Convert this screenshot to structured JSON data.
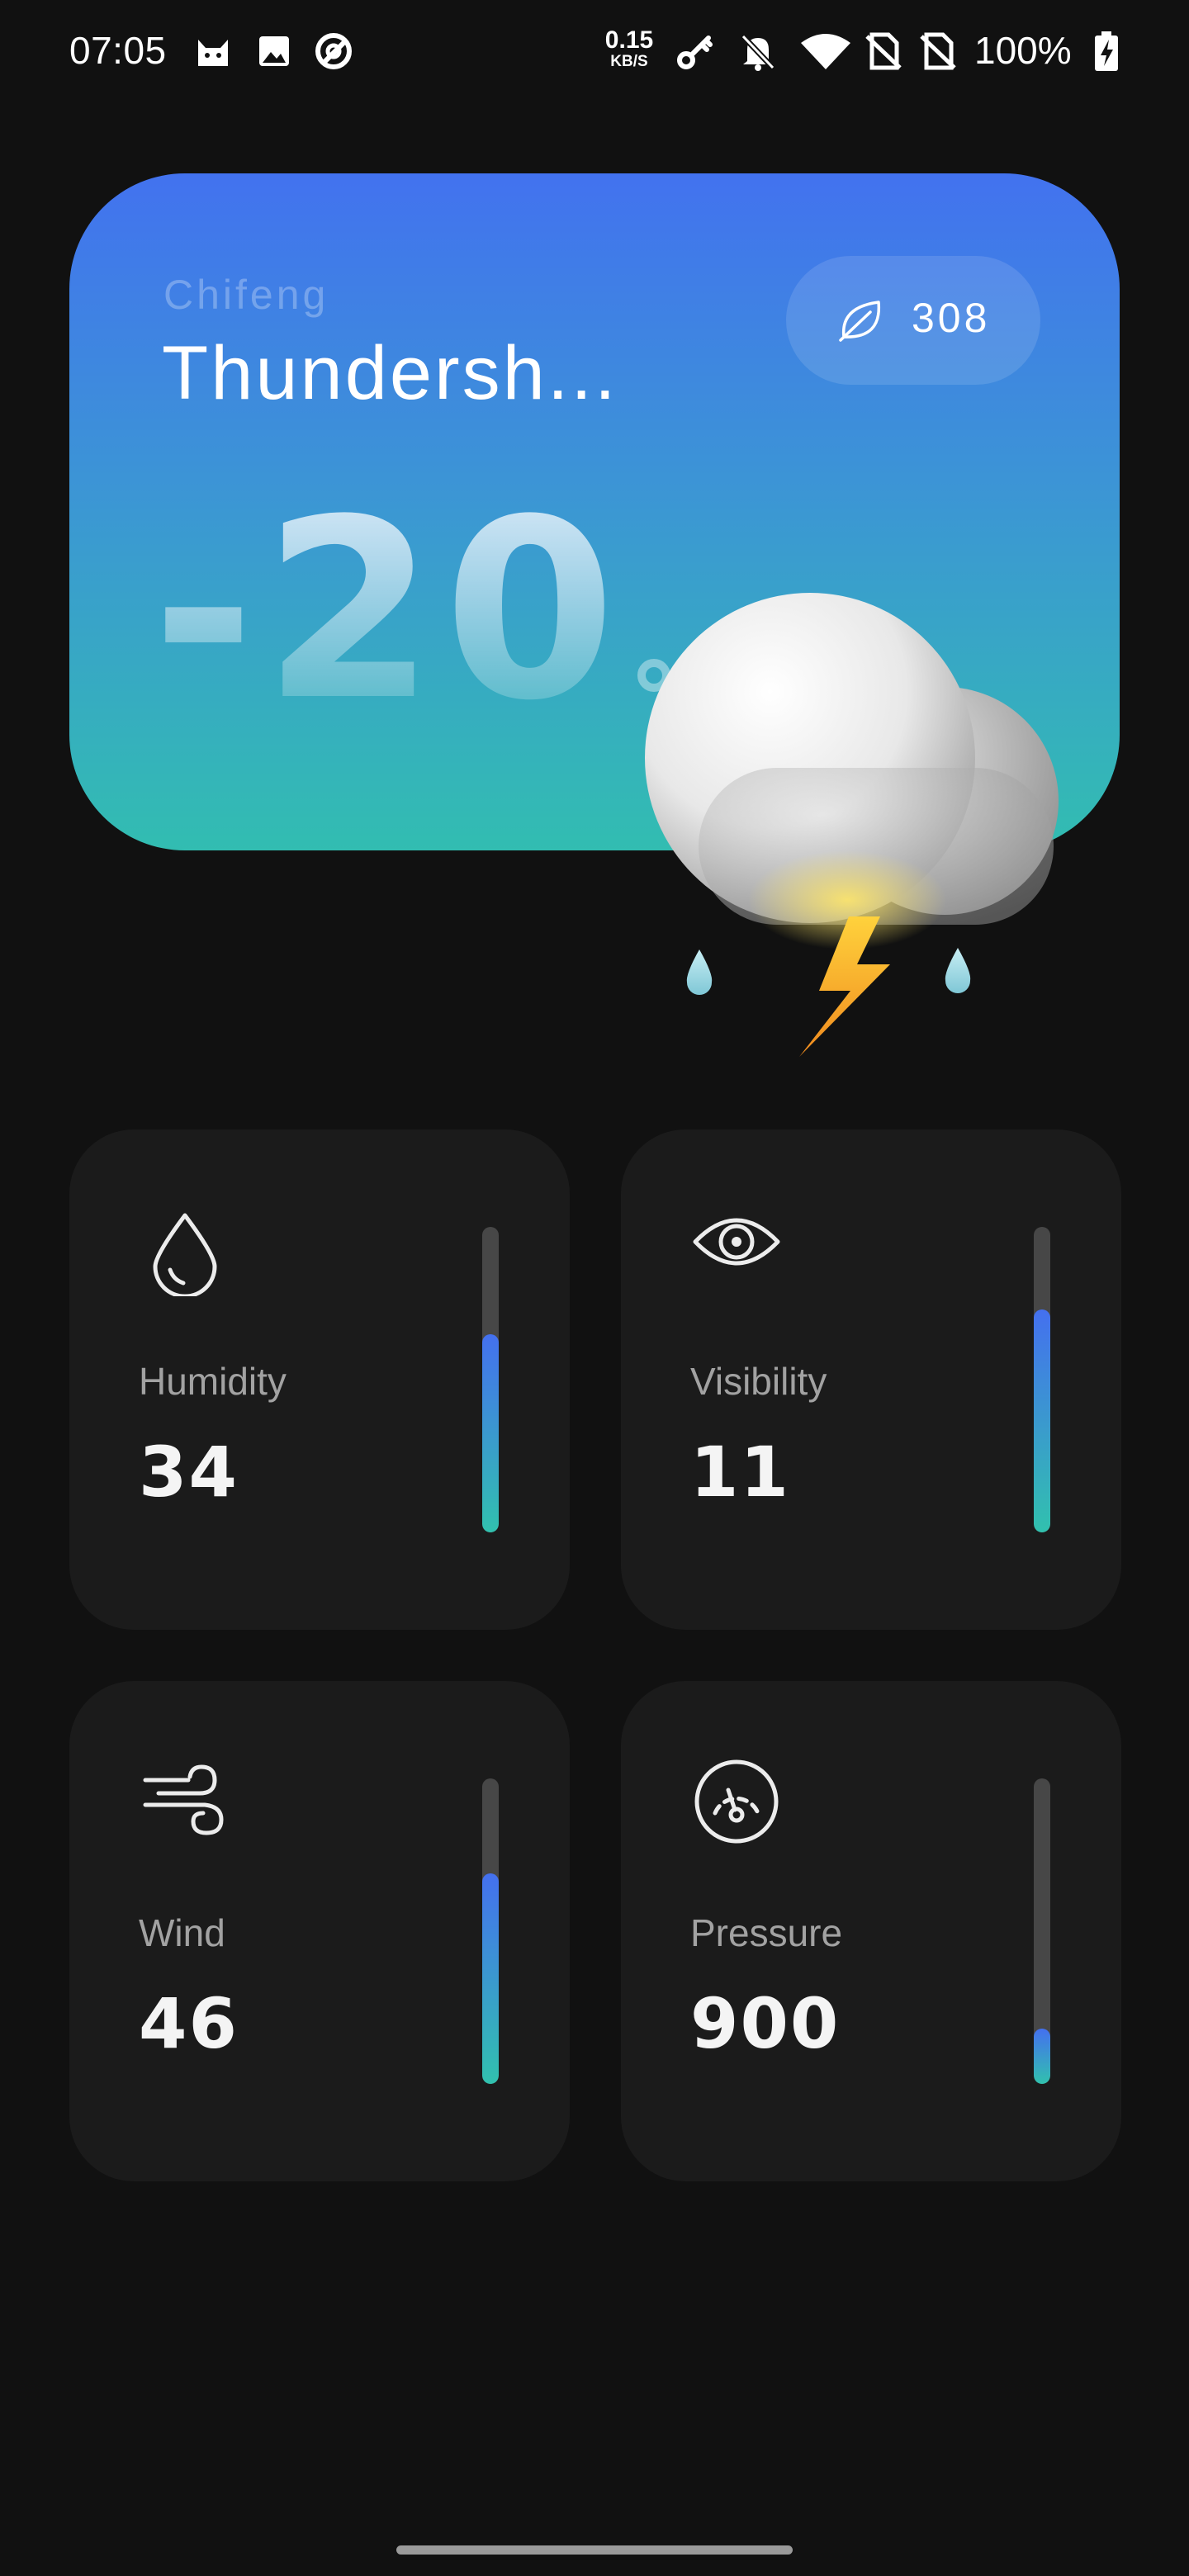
{
  "status_bar": {
    "time": "07:05",
    "net_speed_value": "0.15",
    "net_speed_unit": "KB/S",
    "battery_percent": "100%",
    "icons": [
      "cat-icon",
      "image-icon",
      "circle-slash-icon",
      "key-icon",
      "bell-off-icon",
      "wifi-icon",
      "no-sim-icon",
      "no-sim-icon",
      "battery-charging-icon"
    ]
  },
  "weather": {
    "city": "Chifeng",
    "condition": "Thundersh...",
    "aqi": "308",
    "aqi_icon": "leaf-icon",
    "temperature": "-20",
    "illustration": "thunderstorm-cloud-icon"
  },
  "metrics": [
    {
      "label": "Humidity",
      "value": "34",
      "icon": "water-drop-icon",
      "level": 0.65
    },
    {
      "label": "Visibility",
      "value": "11",
      "icon": "eye-icon",
      "level": 0.73
    },
    {
      "label": "Wind",
      "value": "46",
      "icon": "wind-icon",
      "level": 0.69
    },
    {
      "label": "Pressure",
      "value": "900",
      "icon": "gauge-icon",
      "level": 0.18
    }
  ],
  "colors": {
    "background": "#111111",
    "card": "#1b1b1b",
    "hero_gradient_top": "#4272ef",
    "hero_gradient_bottom": "#32bdb1",
    "bar_gradient_top": "#4470ef",
    "bar_gradient_bottom": "#31c1ae",
    "bar_track": "#474747"
  }
}
